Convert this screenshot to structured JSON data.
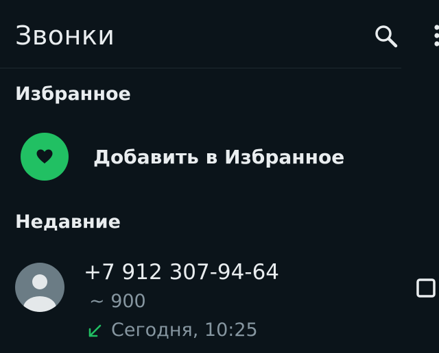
{
  "app_bar": {
    "title": "Звонки",
    "icons": [
      "search-icon",
      "more-vert-icon"
    ]
  },
  "favorites": {
    "section_title": "Избранное",
    "add_label": "Добавить в Избранное",
    "icon": "heart-icon"
  },
  "recent": {
    "section_title": "Недавние",
    "calls": [
      {
        "name": "+7 912 307-94-64",
        "subtitle": "~ 900",
        "time": "Сегодня, 10:25",
        "direction": "incoming",
        "icons": [
          "default-avatar-icon",
          "incoming-arrow-icon",
          "video-call-icon"
        ]
      }
    ]
  },
  "colors": {
    "background": "#0b141a",
    "accent": "#21c063",
    "text_primary": "#e9edef",
    "text_secondary": "#8696a0",
    "avatar_bg": "#6b7c85"
  }
}
